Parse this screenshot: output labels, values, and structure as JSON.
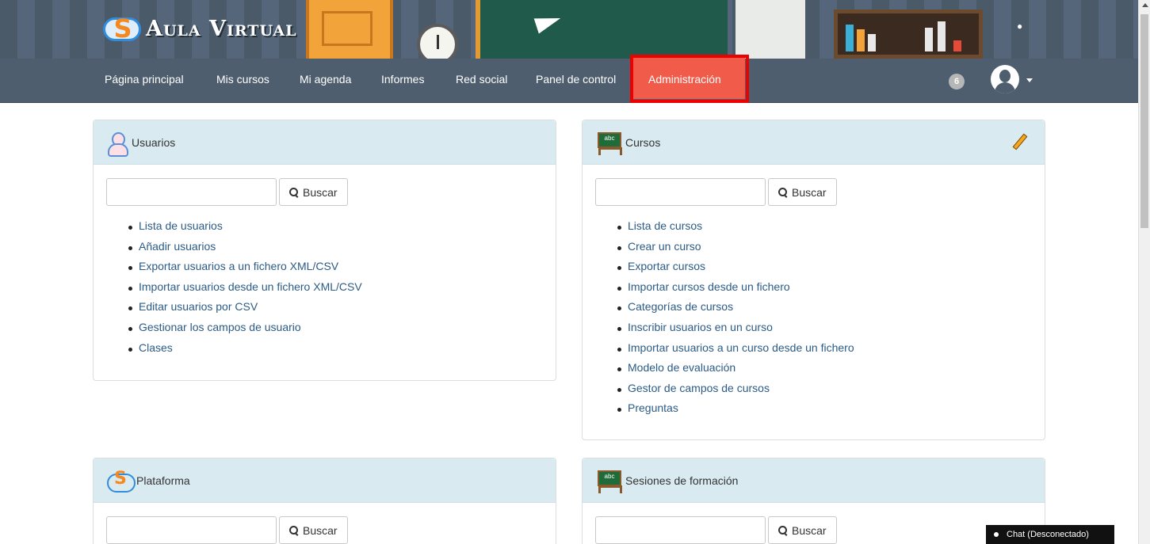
{
  "header": {
    "brand": "Aula Virtual"
  },
  "nav": {
    "items": [
      "Página principal",
      "Mis cursos",
      "Mi agenda",
      "Informes",
      "Red social",
      "Panel de control",
      "Administración"
    ],
    "active": "Administración",
    "notifications_count": "6"
  },
  "panels": {
    "usuarios": {
      "title": "Usuarios",
      "search_button": "Buscar",
      "links": [
        "Lista de usuarios",
        "Añadir usuarios",
        "Exportar usuarios a un fichero XML/CSV",
        "Importar usuarios desde un fichero XML/CSV",
        "Editar usuarios por CSV",
        "Gestionar los campos de usuario",
        "Clases"
      ]
    },
    "cursos": {
      "title": "Cursos",
      "search_button": "Buscar",
      "links": [
        "Lista de cursos",
        "Crear un curso",
        "Exportar cursos",
        "Importar cursos desde un fichero",
        "Categorías de cursos",
        "Inscribir usuarios en un curso",
        "Importar usuarios a un curso desde un fichero",
        "Modelo de evaluación",
        "Gestor de campos de cursos",
        "Preguntas"
      ]
    },
    "plataforma": {
      "title": "Plataforma",
      "search_button": "Buscar"
    },
    "sesiones": {
      "title": "Sesiones de formación",
      "search_button": "Buscar"
    }
  },
  "chat": {
    "label": "Chat (Desconectado)"
  },
  "colors": {
    "nav_bg": "#4e5e6e",
    "active_tab": "#f15c4a",
    "highlight_border": "#ee0000",
    "panel_header": "#d9eaf0",
    "link": "#2b5b86"
  }
}
